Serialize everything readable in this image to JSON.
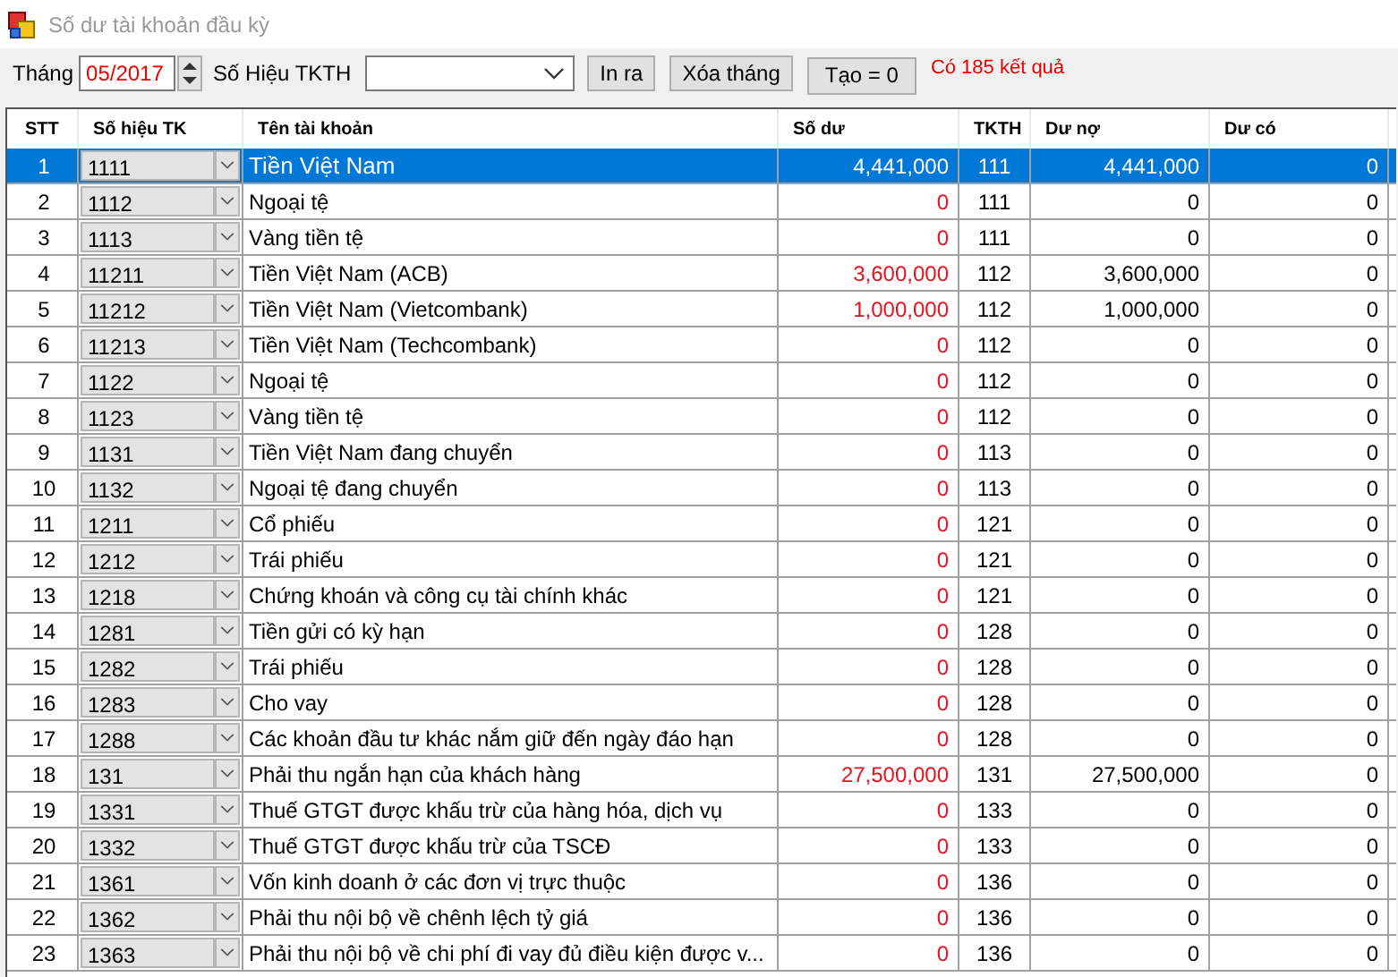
{
  "window": {
    "title": "Số dư tài khoản đầu kỳ"
  },
  "toolbar": {
    "month_label": "Tháng",
    "month_value": "05/2017",
    "tkth_label": "Số Hiệu TKTH",
    "buttons": [
      "In ra",
      "Xóa tháng",
      "Tạo = 0"
    ],
    "result": "Có 185 kết quả"
  },
  "table": {
    "columns": [
      "STT",
      "Số hiệu TK",
      "Tên tài khoản",
      "Số dư",
      "TKTH",
      "Dư nợ",
      "Dư có"
    ],
    "rows": [
      {
        "stt": "1",
        "tk": "1111",
        "name": "Tiền Việt Nam",
        "so_du": "4,441,000",
        "tkth": "111",
        "du_no": "4,441,000",
        "du_co": "0",
        "selected": true
      },
      {
        "stt": "2",
        "tk": "1112",
        "name": "Ngoại tệ",
        "so_du": "0",
        "tkth": "111",
        "du_no": "0",
        "du_co": "0",
        "selected": false
      },
      {
        "stt": "3",
        "tk": "1113",
        "name": "Vàng tiền tệ",
        "so_du": "0",
        "tkth": "111",
        "du_no": "0",
        "du_co": "0",
        "selected": false
      },
      {
        "stt": "4",
        "tk": "11211",
        "name": "Tiền Việt Nam (ACB)",
        "so_du": "3,600,000",
        "tkth": "112",
        "du_no": "3,600,000",
        "du_co": "0",
        "selected": false
      },
      {
        "stt": "5",
        "tk": "11212",
        "name": "Tiền Việt Nam (Vietcombank)",
        "so_du": "1,000,000",
        "tkth": "112",
        "du_no": "1,000,000",
        "du_co": "0",
        "selected": false
      },
      {
        "stt": "6",
        "tk": "11213",
        "name": "Tiền Việt Nam (Techcombank)",
        "so_du": "0",
        "tkth": "112",
        "du_no": "0",
        "du_co": "0",
        "selected": false
      },
      {
        "stt": "7",
        "tk": "1122",
        "name": "Ngoại tệ",
        "so_du": "0",
        "tkth": "112",
        "du_no": "0",
        "du_co": "0",
        "selected": false
      },
      {
        "stt": "8",
        "tk": "1123",
        "name": "Vàng tiền tệ",
        "so_du": "0",
        "tkth": "112",
        "du_no": "0",
        "du_co": "0",
        "selected": false
      },
      {
        "stt": "9",
        "tk": "1131",
        "name": "Tiền Việt Nam đang chuyển",
        "so_du": "0",
        "tkth": "113",
        "du_no": "0",
        "du_co": "0",
        "selected": false
      },
      {
        "stt": "10",
        "tk": "1132",
        "name": "Ngoại tệ đang chuyển",
        "so_du": "0",
        "tkth": "113",
        "du_no": "0",
        "du_co": "0",
        "selected": false
      },
      {
        "stt": "11",
        "tk": "1211",
        "name": "Cổ phiếu",
        "so_du": "0",
        "tkth": "121",
        "du_no": "0",
        "du_co": "0",
        "selected": false
      },
      {
        "stt": "12",
        "tk": "1212",
        "name": "Trái phiếu",
        "so_du": "0",
        "tkth": "121",
        "du_no": "0",
        "du_co": "0",
        "selected": false
      },
      {
        "stt": "13",
        "tk": "1218",
        "name": "Chứng khoán và công cụ tài chính khác",
        "so_du": "0",
        "tkth": "121",
        "du_no": "0",
        "du_co": "0",
        "selected": false
      },
      {
        "stt": "14",
        "tk": "1281",
        "name": "Tiền gửi có kỳ hạn",
        "so_du": "0",
        "tkth": "128",
        "du_no": "0",
        "du_co": "0",
        "selected": false
      },
      {
        "stt": "15",
        "tk": "1282",
        "name": "Trái phiếu",
        "so_du": "0",
        "tkth": "128",
        "du_no": "0",
        "du_co": "0",
        "selected": false
      },
      {
        "stt": "16",
        "tk": "1283",
        "name": "Cho vay",
        "so_du": "0",
        "tkth": "128",
        "du_no": "0",
        "du_co": "0",
        "selected": false
      },
      {
        "stt": "17",
        "tk": "1288",
        "name": "Các khoản đầu tư khác nắm giữ đến ngày đáo hạn",
        "so_du": "0",
        "tkth": "128",
        "du_no": "0",
        "du_co": "0",
        "selected": false
      },
      {
        "stt": "18",
        "tk": "131",
        "name": "Phải thu ngắn hạn của khách hàng",
        "so_du": "27,500,000",
        "tkth": "131",
        "du_no": "27,500,000",
        "du_co": "0",
        "selected": false
      },
      {
        "stt": "19",
        "tk": "1331",
        "name": "Thuế GTGT được khấu trừ của hàng hóa, dịch vụ",
        "so_du": "0",
        "tkth": "133",
        "du_no": "0",
        "du_co": "0",
        "selected": false
      },
      {
        "stt": "20",
        "tk": "1332",
        "name": "Thuế GTGT được khấu trừ của TSCĐ",
        "so_du": "0",
        "tkth": "133",
        "du_no": "0",
        "du_co": "0",
        "selected": false
      },
      {
        "stt": "21",
        "tk": "1361",
        "name": "Vốn kinh doanh ở các đơn vị trực thuộc",
        "so_du": "0",
        "tkth": "136",
        "du_no": "0",
        "du_co": "0",
        "selected": false
      },
      {
        "stt": "22",
        "tk": "1362",
        "name": "Phải thu nội bộ về chênh lệch tỷ giá",
        "so_du": "0",
        "tkth": "136",
        "du_no": "0",
        "du_co": "0",
        "selected": false
      },
      {
        "stt": "23",
        "tk": "1363",
        "name": "Phải thu nội bộ về chi phí đi vay đủ điều kiện được v...",
        "so_du": "0",
        "tkth": "136",
        "du_no": "0",
        "du_co": "0",
        "selected": false
      }
    ]
  }
}
